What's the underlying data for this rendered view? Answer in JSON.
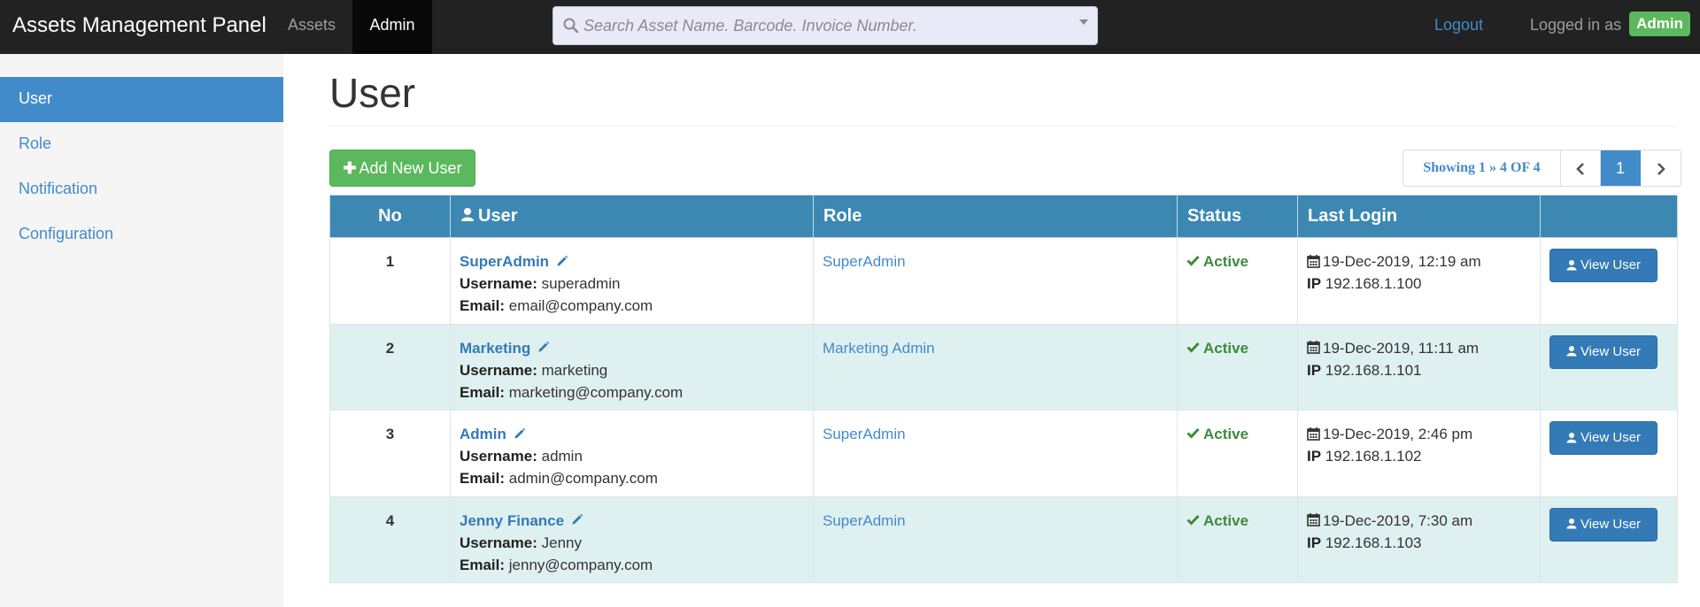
{
  "navbar": {
    "brand": "Assets Management Panel",
    "links": [
      {
        "label": "Assets",
        "active": false
      },
      {
        "label": "Admin",
        "active": true
      }
    ],
    "search_placeholder": "Search Asset Name. Barcode. Invoice Number.",
    "logout": "Logout",
    "logged_in_text": "Logged in as",
    "user_badge": "Admin"
  },
  "sidebar": {
    "items": [
      {
        "label": "User",
        "active": true
      },
      {
        "label": "Role",
        "active": false
      },
      {
        "label": "Notification",
        "active": false
      },
      {
        "label": "Configuration",
        "active": false
      }
    ]
  },
  "main": {
    "title": "User",
    "add_button": "Add New User",
    "pager": {
      "info": "Showing 1 » 4 OF 4",
      "current_page": "1"
    },
    "table": {
      "headers": {
        "no": "No",
        "user": "User",
        "role": "Role",
        "status": "Status",
        "last_login": "Last Login"
      },
      "labels": {
        "username": "Username:",
        "email": "Email:",
        "ip": "IP"
      },
      "rows": [
        {
          "no": "1",
          "name": "SuperAdmin",
          "username": "superadmin",
          "email": "email@company.com",
          "role": "SuperAdmin",
          "status": "Active",
          "login": "19-Dec-2019, 12:19 am",
          "ip": "192.168.1.100",
          "action": "View User"
        },
        {
          "no": "2",
          "name": "Marketing",
          "username": "marketing",
          "email": "marketing@company.com",
          "role": "Marketing Admin",
          "status": "Active",
          "login": "19-Dec-2019, 11:11 am",
          "ip": "192.168.1.101",
          "action": "View User"
        },
        {
          "no": "3",
          "name": "Admin",
          "username": "admin",
          "email": "admin@company.com",
          "role": "SuperAdmin",
          "status": "Active",
          "login": "19-Dec-2019, 2:46 pm",
          "ip": "192.168.1.102",
          "action": "View User"
        },
        {
          "no": "4",
          "name": "Jenny Finance",
          "username": "Jenny",
          "email": "jenny@company.com",
          "role": "SuperAdmin",
          "status": "Active",
          "login": "19-Dec-2019, 7:30 am",
          "ip": "192.168.1.103",
          "action": "View User"
        }
      ]
    }
  },
  "colors": {
    "navbar_bg": "#222222",
    "primary": "#428bca",
    "success": "#5cb85c",
    "table_header": "#3c88b3",
    "row_alt": "#dff0f0",
    "status_active": "#3c8b3c"
  },
  "icons": {
    "search": "search-icon",
    "add": "plus-icon",
    "user": "user-icon",
    "edit": "pencil-icon",
    "status": "check-icon",
    "date": "calendar-icon",
    "prev": "chevron-left-icon",
    "next": "chevron-right-icon"
  }
}
